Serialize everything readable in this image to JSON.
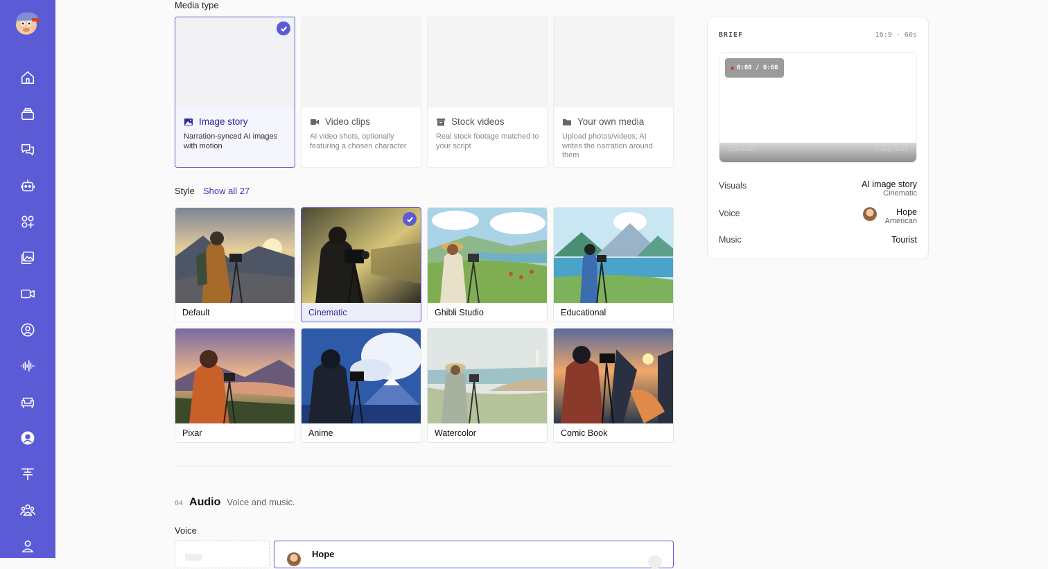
{
  "media": {
    "label": "Media type",
    "cards": [
      {
        "title": "Image story",
        "desc": "Narration-synced AI images with motion",
        "icon": "image-icon",
        "selected": true
      },
      {
        "title": "Video clips",
        "desc": "AI video shots, optionally featuring a chosen character",
        "icon": "video-camera-icon",
        "selected": false
      },
      {
        "title": "Stock videos",
        "desc": "Real stock footage matched to your script",
        "icon": "archive-icon",
        "selected": false
      },
      {
        "title": "Your own media",
        "desc": "Upload photos/videos; AI writes the narration around them",
        "icon": "folder-icon",
        "selected": false
      }
    ]
  },
  "style": {
    "label": "Style",
    "show_all": "Show all 27",
    "options": [
      "Default",
      "Cinematic",
      "Ghibli Studio",
      "Educational",
      "Pixar",
      "Anime",
      "Watercolor",
      "Comic Book"
    ],
    "selected": "Cinematic"
  },
  "audio": {
    "num": "04",
    "title": "Audio",
    "subtitle": "Voice and music.",
    "voice_label": "Voice",
    "voice_name": "Hope"
  },
  "brief": {
    "head": "BRIEF",
    "meta": "16:9 · 60s",
    "timer": "0:00 / 0:60",
    "cap_left": "Cinematic",
    "cap_right": "Image story",
    "rows": [
      {
        "key": "Visuals",
        "value": "AI image story",
        "sub": "Cinematic"
      },
      {
        "key": "Voice",
        "value": "Hope",
        "sub": "American"
      },
      {
        "key": "Music",
        "value": "Tourist",
        "sub": ""
      }
    ]
  },
  "colors": {
    "accent": "#5b5bd6",
    "sidebar": "#5b5bd6"
  }
}
